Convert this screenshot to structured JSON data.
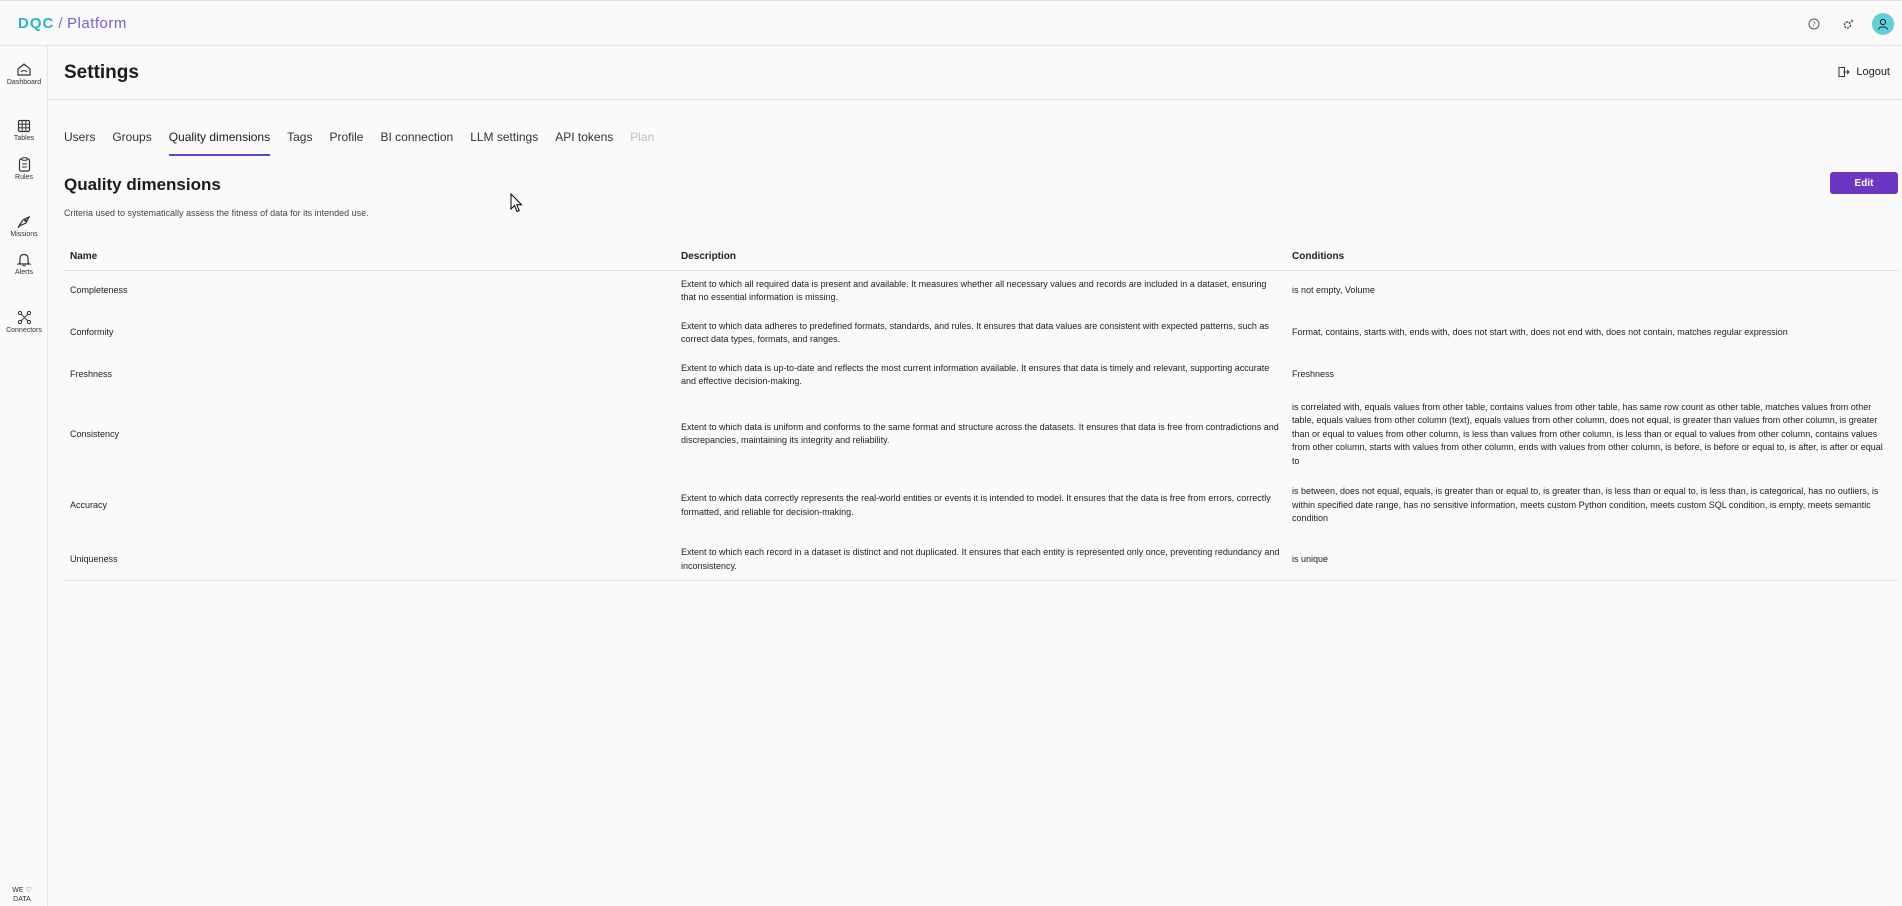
{
  "app": {
    "brand": "DQC",
    "separator": "/",
    "product": "Platform"
  },
  "topbar_icons": [
    "help-icon",
    "settings-sparkle-icon",
    "user-avatar-icon"
  ],
  "sidebar": {
    "items": [
      {
        "label": "Dashboard",
        "icon": "home-icon"
      },
      {
        "label": "Tables",
        "icon": "table-icon"
      },
      {
        "label": "Rules",
        "icon": "clipboard-icon"
      },
      {
        "label": "Missions",
        "icon": "missions-icon"
      },
      {
        "label": "Alerts",
        "icon": "bell-icon"
      },
      {
        "label": "Connectors",
        "icon": "connectors-icon"
      }
    ],
    "footer_line1": "WE ♡",
    "footer_line2": "DATA"
  },
  "header": {
    "title": "Settings",
    "logout_label": "Logout"
  },
  "tabs": [
    {
      "label": "Users",
      "state": "normal"
    },
    {
      "label": "Groups",
      "state": "normal"
    },
    {
      "label": "Quality dimensions",
      "state": "active"
    },
    {
      "label": "Tags",
      "state": "normal"
    },
    {
      "label": "Profile",
      "state": "normal"
    },
    {
      "label": "BI connection",
      "state": "normal"
    },
    {
      "label": "LLM settings",
      "state": "normal"
    },
    {
      "label": "API tokens",
      "state": "normal"
    },
    {
      "label": "Plan",
      "state": "disabled"
    }
  ],
  "section": {
    "title": "Quality dimensions",
    "subtitle": "Criteria used to systematically assess the fitness of data for its intended use.",
    "edit_label": "Edit"
  },
  "table": {
    "columns": [
      "Name",
      "Description",
      "Conditions"
    ],
    "rows": [
      {
        "name": "Completeness",
        "description": "Extent to which all required data is present and available. It measures whether all necessary values and records are included in a dataset, ensuring that no essential information is missing.",
        "conditions": "is not empty, Volume"
      },
      {
        "name": "Conformity",
        "description": "Extent to which data adheres to predefined formats, standards, and rules. It ensures that data values are consistent with expected patterns, such as correct data types, formats, and ranges.",
        "conditions": "Format, contains, starts with, ends with, does not start with, does not end with, does not contain, matches regular expression"
      },
      {
        "name": "Freshness",
        "description": "Extent to which data is up-to-date and reflects the most current information available. It ensures that data is timely and relevant, supporting accurate and effective decision-making.",
        "conditions": "Freshness"
      },
      {
        "name": "Consistency",
        "description": "Extent to which data is uniform and conforms to the same format and structure across the datasets. It ensures that data is free from contradictions and discrepancies, maintaining its integrity and reliability.",
        "conditions": "is correlated with, equals values from other table, contains values from other table, has same row count as other table, matches values from other table, equals values from other column (text), equals values from other column, does not equal, is greater than values from other column, is greater than or equal to values from other column, is less than values from other column, is less than or equal to values from other column, contains values from other column, starts with values from other column, ends with values from other column, is before, is before or equal to, is after, is after or equal to"
      },
      {
        "name": "Accuracy",
        "description": "Extent to which data correctly represents the real-world entities or events it is intended to model. It ensures that the data is free from errors, correctly formatted, and reliable for decision-making.",
        "conditions": "is between, does not equal, equals, is greater than or equal to, is greater than, is less than or equal to, is less than, is categorical, has no outliers, is within specified date range, has no sensitive information, meets custom Python condition, meets custom SQL condition, is empty, meets semantic condition"
      },
      {
        "name": "Uniqueness",
        "description": "Extent to which each record in a dataset is distinct and not duplicated. It ensures that each entity is represented only once, preventing redundancy and inconsistency.",
        "conditions": "is unique"
      }
    ]
  },
  "colors": {
    "accent": "#6a36c2",
    "brand_teal": "#2bb3c0",
    "avatar": "#5fd0d8"
  }
}
